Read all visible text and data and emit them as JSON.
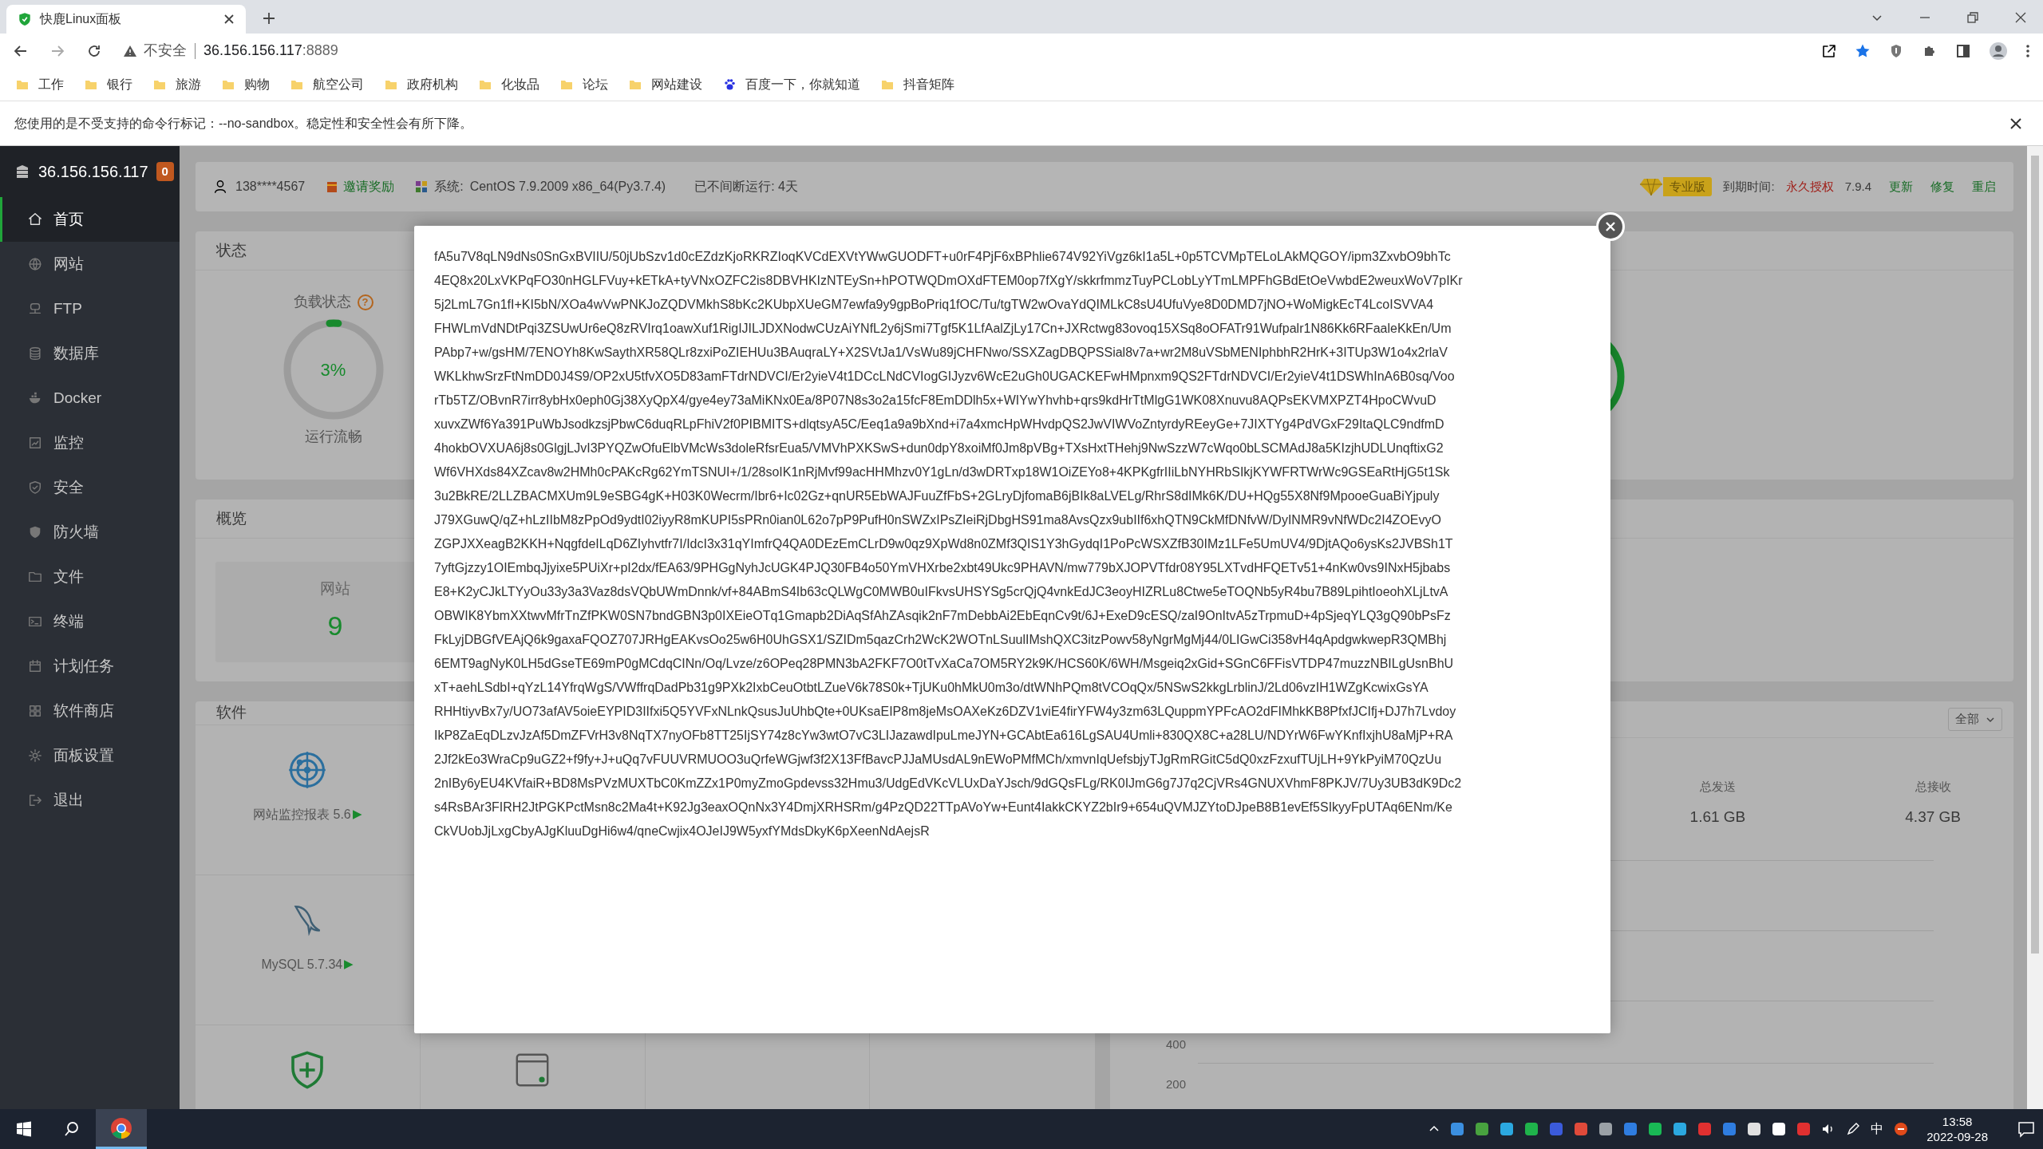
{
  "browser": {
    "tab_title": "快鹿Linux面板",
    "security": "不安全",
    "url_host": "36.156.156.117",
    "url_port": ":8889",
    "bookmarks": [
      {
        "label": "工作",
        "kind": "folder"
      },
      {
        "label": "银行",
        "kind": "folder"
      },
      {
        "label": "旅游",
        "kind": "folder"
      },
      {
        "label": "购物",
        "kind": "folder"
      },
      {
        "label": "航空公司",
        "kind": "folder"
      },
      {
        "label": "政府机构",
        "kind": "folder"
      },
      {
        "label": "化妆品",
        "kind": "folder"
      },
      {
        "label": "论坛",
        "kind": "folder"
      },
      {
        "label": "网站建设",
        "kind": "folder"
      },
      {
        "label": "百度一下，你就知道",
        "kind": "site"
      },
      {
        "label": "抖音矩阵",
        "kind": "folder"
      }
    ],
    "infobar": "您使用的是不受支持的命令行标记：--no-sandbox。稳定性和安全性会有所下降。"
  },
  "sidebar": {
    "host": "36.156.156.117",
    "badge": "0",
    "items": [
      {
        "label": "首页",
        "selected": true
      },
      {
        "label": "网站",
        "selected": false
      },
      {
        "label": "FTP",
        "selected": false
      },
      {
        "label": "数据库",
        "selected": false
      },
      {
        "label": "Docker",
        "selected": false
      },
      {
        "label": "监控",
        "selected": false
      },
      {
        "label": "安全",
        "selected": false
      },
      {
        "label": "防火墙",
        "selected": false
      },
      {
        "label": "文件",
        "selected": false
      },
      {
        "label": "终端",
        "selected": false
      },
      {
        "label": "计划任务",
        "selected": false
      },
      {
        "label": "软件商店",
        "selected": false
      },
      {
        "label": "面板设置",
        "selected": false
      },
      {
        "label": "退出",
        "selected": false
      }
    ]
  },
  "header": {
    "user": "138****4567",
    "invite": "邀请奖励",
    "system_label": "系统:",
    "system": "CentOS 7.9.2009 x86_64(Py3.7.4)",
    "uptime": "已不间断运行: 4天",
    "edition": "专业版",
    "expiry_label": "到期时间:",
    "expiry": "永久授权",
    "version": "7.9.4",
    "actions": [
      "更新",
      "修复",
      "重启"
    ]
  },
  "status": {
    "title": "状态",
    "load_label": "负载状态",
    "help": "?",
    "load_value": "3%",
    "level": 0.03,
    "load_text": "运行流畅"
  },
  "overview": {
    "title": "概览",
    "site_label": "网站",
    "site_count": "9"
  },
  "software": {
    "title": "软件",
    "items": [
      {
        "kind": "labeled",
        "label": "网站监控报表 5.6",
        "arrow": "▶"
      },
      {
        "kind": "labeled",
        "label": "MySQL 5.7.34",
        "arrow": "▶"
      },
      {
        "kind": "cut"
      },
      {
        "kind": "cut"
      }
    ]
  },
  "traffic": {
    "filter": "全部",
    "stats": [
      {
        "label": "总发送",
        "value": "1.61 GB"
      },
      {
        "label": "总接收",
        "value": "4.37 GB"
      }
    ],
    "axis_labels": [
      "400",
      "200"
    ]
  },
  "modal": {
    "lines": [
      "fA5u7V8qLN9dNs0SnGxBVIIU/50jUbSzv1d0cEZdzKjoRKRZIoqKVCdEXVtYWwGUODFT+u0rF4PjF6xBPhlie674V92YiVgz6kI1a5L+0p5TCVMpTELoLAkMQGOY/ipm3ZxvbO9bhTc",
      "4EQ8x20LxVKPqFO30nHGLFVuy+kETkA+tyVNxOZFC2is8DBVHKIzNTEySn+hPOTWQDmOXdFTEM0op7fXgY/skkrfmmzTuyPCLobLyYTmLMPFhGBdEtOeVwbdE2weuxWoV7pIKr",
      "5j2LmL7Gn1fI+KI5bN/XOa4wVwPNKJoZQDVMkhS8bKc2KUbpXUeGM7ewfa9y9gpBoPriq1fOC/Tu/tgTW2wOvaYdQIMLkC8sU4UfuVye8D0DMD7jNO+WoMigkEcT4LcoISVVA4",
      "FHWLmVdNDtPqi3ZSUwUr6eQ8zRVIrq1oawXuf1RigIJILJDXNodwCUzAiYNfL2y6jSmi7Tgf5K1LfAalZjLy17Cn+JXRctwg83ovoq15XSq8oOFATr91Wufpalr1N86Kk6RFaaleKkEn/Um",
      "PAbp7+w/gsHM/7ENOYh8KwSaythXR58QLr8zxiPoZIEHUu3BAuqraLY+X2SVtJa1/VsWu89jCHFNwo/SSXZagDBQPSSial8v7a+wr2M8uVSbMENIphbhR2HrK+3ITUp3W1o4x2rlaV",
      "WKLkhwSrzFtNmDD0J4S9/OP2xU5tfvXO5D83amFTdrNDVCI/Er2yieV4t1DCcLNdCVIogGIJyzv6WcE2uGh0UGACKEFwHMpnxm9QS2FTdrNDVCI/Er2yieV4t1DSWhInA6B0sq/Voo",
      "rTb5TZ/OBvnR7irr8ybHx0eph0Gj38XyQpX4/gye4ey73aMiKNx0Ea/8P07N8s3o2a15fcF8EmDDlh5x+WIYwYhvhb+qrs9kdHrTtMlgG1WK08Xnuvu8AQPsEKVMXPZT4HpoCWvuD",
      "xuvxZWf6Ya391PuWbJsodkzsjPbwC6duqRLpFhiV2f0PIBMITS+dlqtsyA5C/Eeq1a9a9bXnd+i7a4xmcHpWHvdpQS2JwVIWVoZntyrdyREeyGe+7JIXTYg4PdVGxF29ItaQLC9ndfmD",
      "4hokbOVXUA6j8s0GlgjLJvI3PYQZwOfuElbVMcWs3doleRfsrEua5/VMVhPXKSwS+dun0dpY8xoiMf0Jm8pVBg+TXsHxtTHehj9NwSzzW7cWqo0bLSCMAdJ8a5KIzjhUDLUnqftixG2",
      "Wf6VHXds84XZcav8w2HMh0cPAKcRg62YmTSNUI+/1/28soIK1nRjMvf99acHHMhzv0Y1gLn/d3wDRTxp18W1OiZEYo8+4KPKgfrIIiLbNYHRbSIkjKYWFRTWrWc9GSEaRtHjG5t1Sk",
      "3u2BkRE/2LLZBACMXUm9L9eSBG4gK+H03K0Wecrm/Ibr6+Ic02Gz+qnUR5EbWAJFuuZfFbS+2GLryDjfomaB6jBIk8aLVELg/RhrS8dIMk6K/DU+HQg55X8Nf9MpooeGuaBiYjpuly",
      "J79XGuwQ/qZ+hLzIIbM8zPpOd9ydtI02iyyR8mKUPI5sPRn0ian0L62o7pP9PufH0nSWZxIPsZIeiRjDbgHS91ma8AvsQzx9ubIIf6xhQTN9CkMfDNfvW/DyINMR9vNfWDc2I4ZOEvyO",
      "ZGPJXXeagB2KKH+NqgfdeILqD6ZIyhvtfr7I/IdcI3x31qYImfrQ4QA0DEzEmCLrD9w0qz9XpWd8n0ZMf3QIS1Y3hGydqI1PoPcWSXZfB30IMz1LFe5UmUV4/9DjtAQo6ysKs2JVBSh1T",
      "7yftGjzzy1OIEmbqJjyixe5PUiXr+pI2dx/fEA63/9PHGgNyhJcUGK4PJQ30FB4o50YmVHXrbe2xbt49Ukc9PHAVN/mw779bXJOPVTfdr08Y95LXTvdHFQETv51+4nKw0vs9INxH5jbabs",
      "E8+K2yCJkLTYyOu33y3a3Vaz8dsVQbUWmDnnk/vf+84ABmS4Ib63cQLWgC0MWB0uIFkvsUHSYSg5crQjQ4vnkEdJC3eoyHIZRLu8Ctwe5eTOQNb5yR4bu7B89LpihtIoeohXLjLtvA",
      "OBWIK8YbmXXtwvMfrTnZfPKW0SN7bndGBN3p0IXEieOTq1Gmapb2DiAqSfAhZAsqik2nF7mDebbAi2EbEqnCv9t/6J+ExeD9cESQ/zaI9OnItvA5zTrpmuD+4pSjeqYLQ3gQ90bPsFz",
      "FkLyjDBGfVEAjQ6k9gaxaFQOZ707JRHgEAKvsOo25w6H0UhGSX1/SZIDm5qazCrh2WcK2WOTnLSuulIMshQXC3itzPowv58yNgrMgMj44/0LIGwCi358vH4qApdgwkwepR3QMBhj",
      "6EMT9agNyK0LH5dGseTE69mP0gMCdqCINn/Oq/Lvze/z6OPeq28PMN3bA2FKF7O0tTvXaCa7OM5RY2k9K/HCS60K/6WH/Msgeiq2xGid+SGnC6FFisVTDP47muzzNBILgUsnBhU",
      "xT+aehLSdbI+qYzL14YfrqWgS/VWffrqDadPb31g9PXk2IxbCeuOtbtLZueV6k78S0k+TjUKu0hMkU0m3o/dtWNhPQm8tVCOqQx/5NSwS2kkgLrblinJ/2Ld06vzIH1WZgKcwixGsYA",
      "RHHtiyvBx7y/UO73afAV5oieEYPID3IIfxi5Q5YVFxNLnkQsusJuUhbQte+0UKsaEIP8m8jeMsOAXeKz6DZV1viE4firYFW4y3zm63LQuppmYPFcAO2dFIMhkKB8PfxfJCIfj+DJ7h7Lvdoy",
      "IkP8ZaEqDLzvJzAf5DmZFVrH3v8NqTX7nyOFb8TT25IjSY74z8cYw3wtO7vC3LIJazawdIpuLmeJYN+GCAbtEa616LgSAU4Umli+830QX8C+a28LU/NDYrW6FwYKnfIxjhU8aMjP+RA",
      "2Jf2kEo3WraCp9uGZ2+f9fy+J+uQq7vFUUVRMUOO3uQrfeWGjwf3f2X13FfBavcPJJaMUsdAL9nEWoPMfMCh/xmvnIqUefsbjyTJgRmRGitC5dQ0xzFzxufTUjLH+9YkPyiM70QzUu",
      "2nIBy6yEU4KVfaiR+BD8MsPVzMUXTbC0KmZZx1P0myZmoGpdevss32Hmu3/UdgEdVKcVLUxDaYJsch/9dGQsFLg/RK0IJmG6g7J7q2CjVRs4GNUXVhmF8PKJV/7Uy3UB3dK9Dc2",
      "s4RsBAr3FIRH2JtPGKPctMsn8c2Ma4t+K92Jg3eaxOQnNx3Y4DmjXRHSRm/g4PzQD22TTpAVoYw+Eunt4IakkCKYZ2bIr9+654uQVMJZYtoDJpeB8B1evEf5SIkyyFpUTAq6ENm/Ke",
      "CkVUobJjLxgCbyAJgKluuDgHi6w4/qneCwjix4OJeIJ9W5yxfYMdsDkyK6pXeenNdAejsR"
    ]
  },
  "taskbar": {
    "ime": "中",
    "time": "13:58",
    "date": "2022-09-28"
  }
}
